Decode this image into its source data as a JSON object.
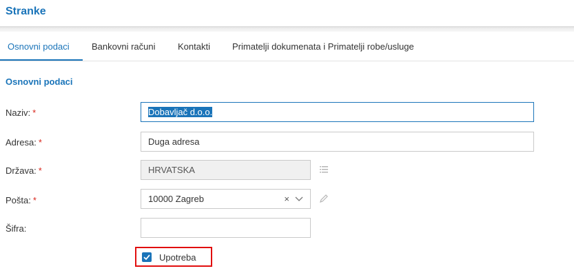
{
  "header": {
    "title": "Stranke"
  },
  "tabs": [
    {
      "label": "Osnovni podaci",
      "active": true
    },
    {
      "label": "Bankovni računi",
      "active": false
    },
    {
      "label": "Kontakti",
      "active": false
    },
    {
      "label": "Primatelji dokumenata i Primatelji robe/usluge",
      "active": false
    }
  ],
  "section": {
    "title": "Osnovni podaci"
  },
  "form": {
    "naziv": {
      "label": "Naziv:",
      "required_mark": "*",
      "value": "Dobavljač d.o.o."
    },
    "adresa": {
      "label": "Adresa:",
      "required_mark": "*",
      "value": "Duga adresa"
    },
    "drzava": {
      "label": "Država:",
      "required_mark": "*",
      "value": "HRVATSKA",
      "side_icon": "list-icon"
    },
    "posta": {
      "label": "Pošta:",
      "required_mark": "*",
      "value": "10000 Zagreb",
      "clear_icon": "×",
      "side_icon": "pencil-icon"
    },
    "sifra": {
      "label": "Šifra:",
      "value": ""
    },
    "upotreba": {
      "label": "Upotreba",
      "checked": true
    }
  },
  "colors": {
    "accent": "#1a74b9",
    "required": "#d9261c",
    "highlight_border": "#e10e0e",
    "disabled_bg": "#f0f0f0"
  }
}
